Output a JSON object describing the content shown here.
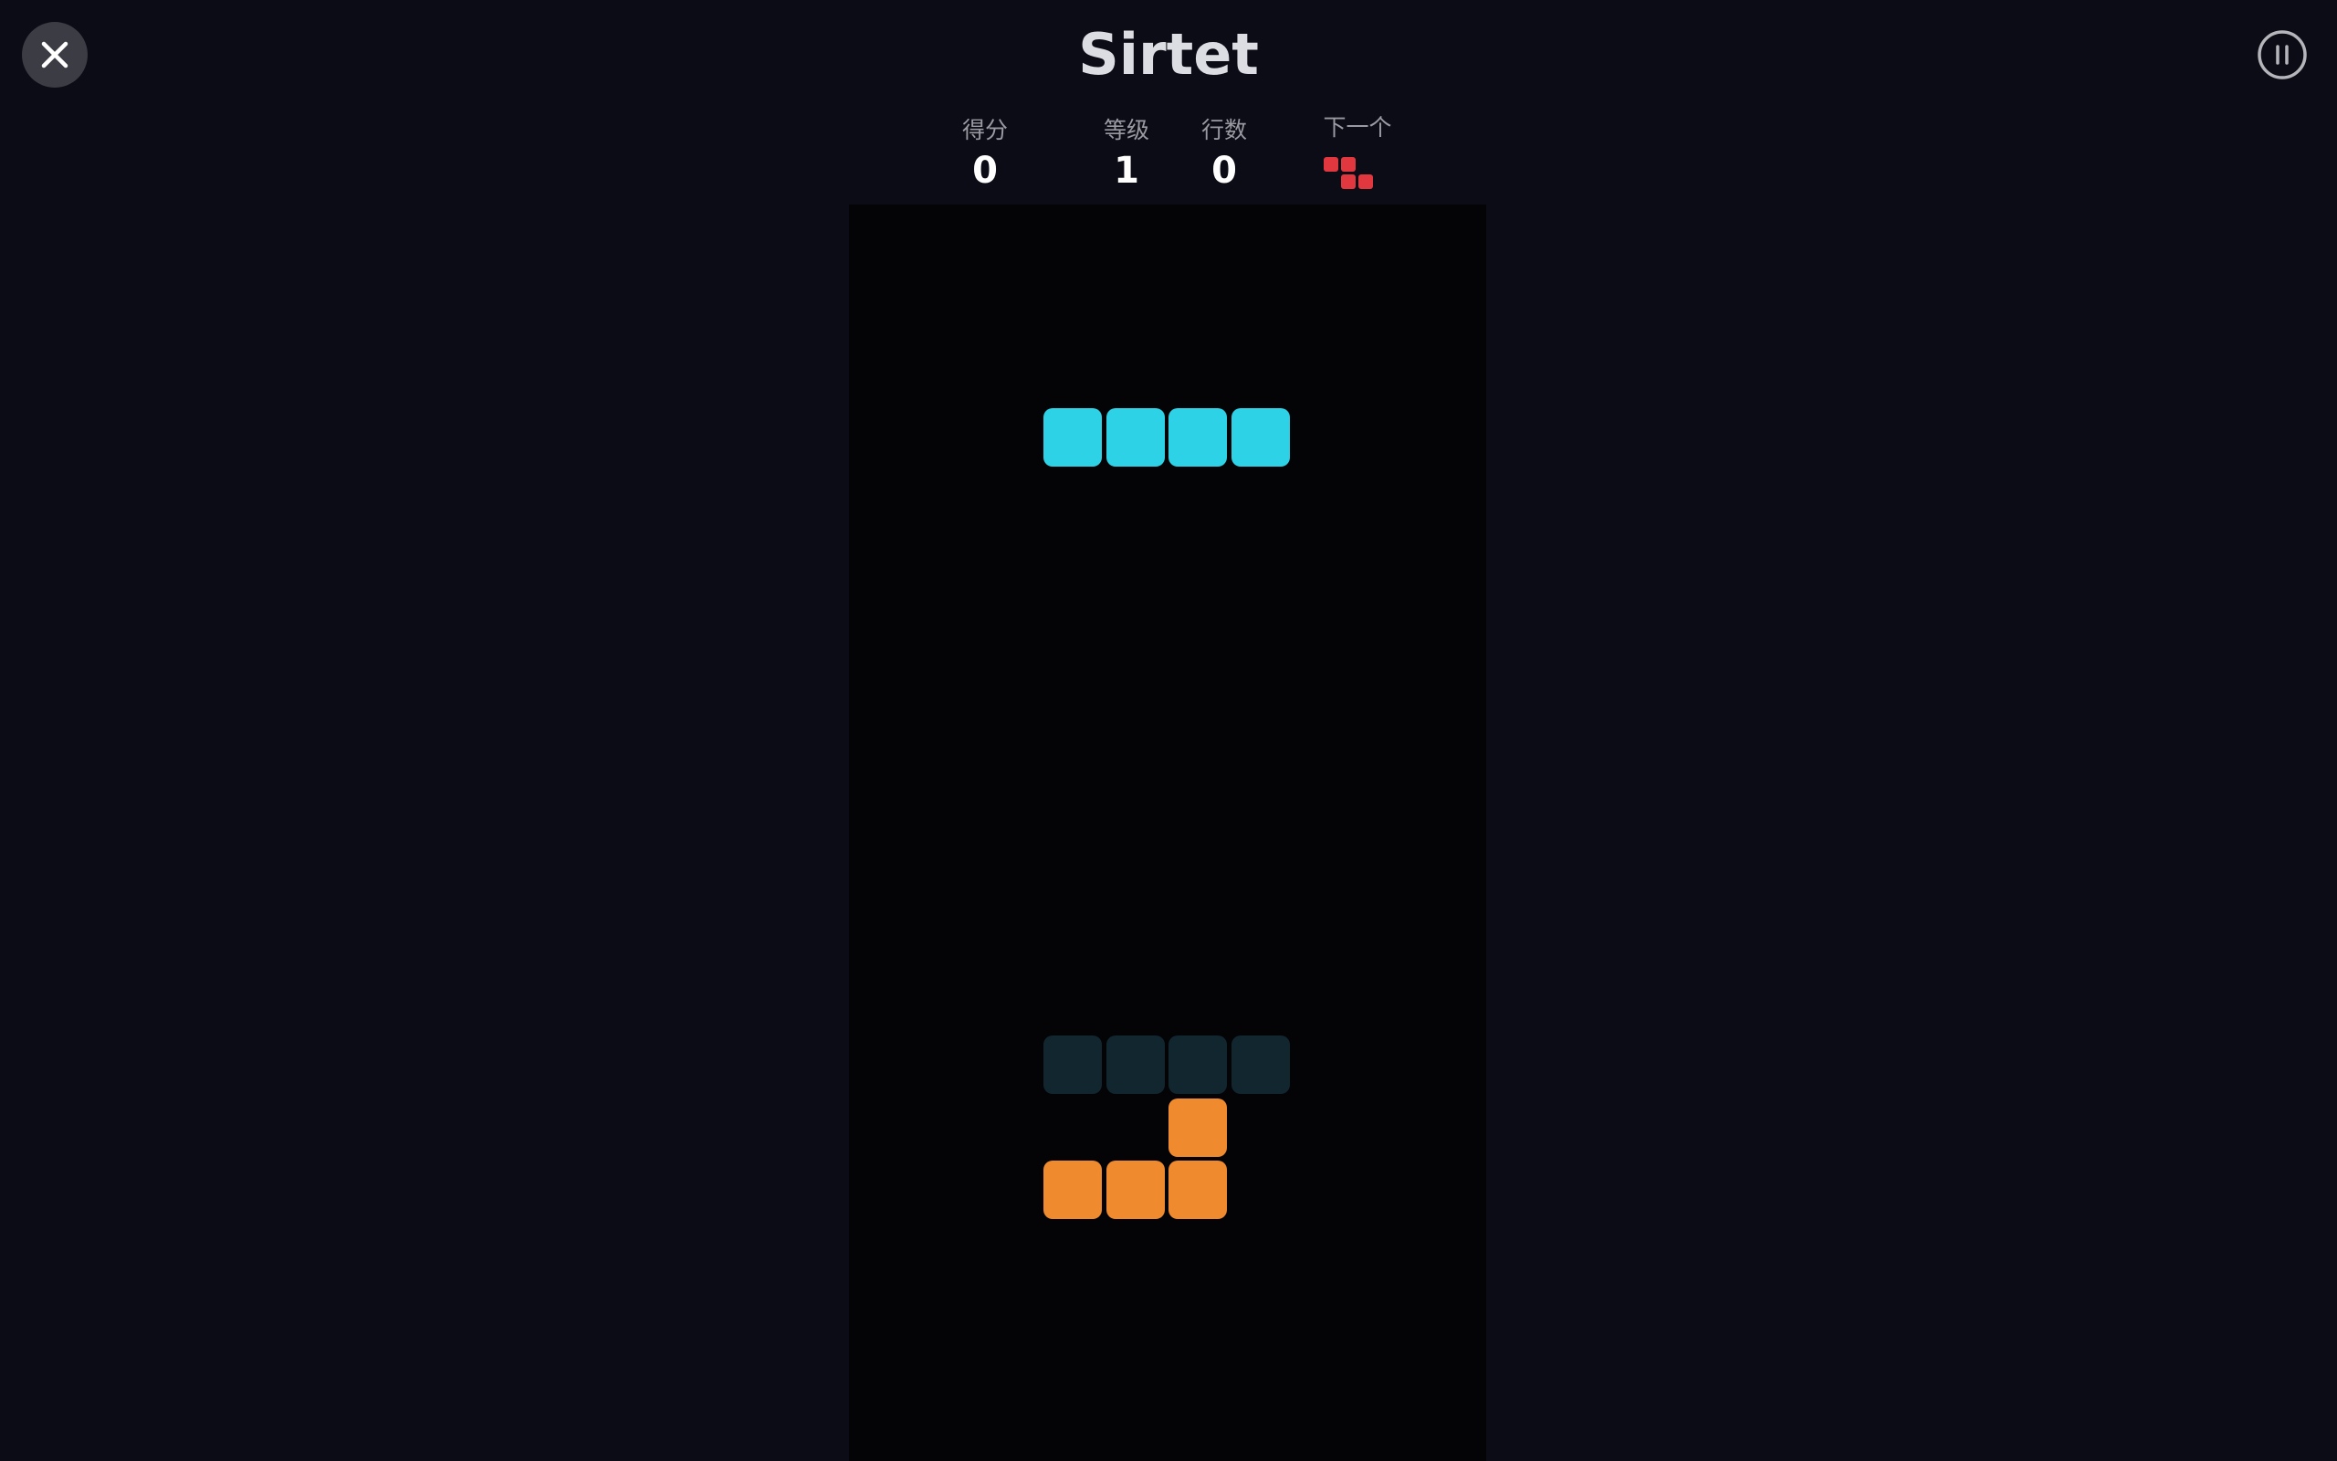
{
  "game": {
    "title": "Sirtet"
  },
  "stats": {
    "score": {
      "label": "得分",
      "value": "0"
    },
    "level": {
      "label": "等级",
      "value": "1"
    },
    "lines": {
      "label": "行数",
      "value": "0"
    },
    "next": {
      "label": "下一个",
      "piece": "Z",
      "color": "#e0383e"
    }
  },
  "board": {
    "columns": 10,
    "active_piece": {
      "type": "I",
      "color": "#2ed2e6",
      "cells": [
        [
          3,
          7
        ],
        [
          4,
          7
        ],
        [
          5,
          7
        ],
        [
          6,
          7
        ]
      ]
    },
    "ghost_piece": {
      "type": "I",
      "color": "#12262f",
      "cells": [
        [
          3,
          17
        ],
        [
          4,
          17
        ],
        [
          5,
          17
        ],
        [
          6,
          17
        ]
      ]
    },
    "locked_cells": {
      "color": "#ef8a2e",
      "cells": [
        [
          5,
          18
        ],
        [
          3,
          19
        ],
        [
          4,
          19
        ],
        [
          5,
          19
        ]
      ]
    }
  },
  "icons": {
    "close": "close-icon",
    "pause": "pause-icon"
  },
  "colors": {
    "background": "#0b0c15",
    "board": "#040407",
    "close_button": "#3b3c44"
  }
}
